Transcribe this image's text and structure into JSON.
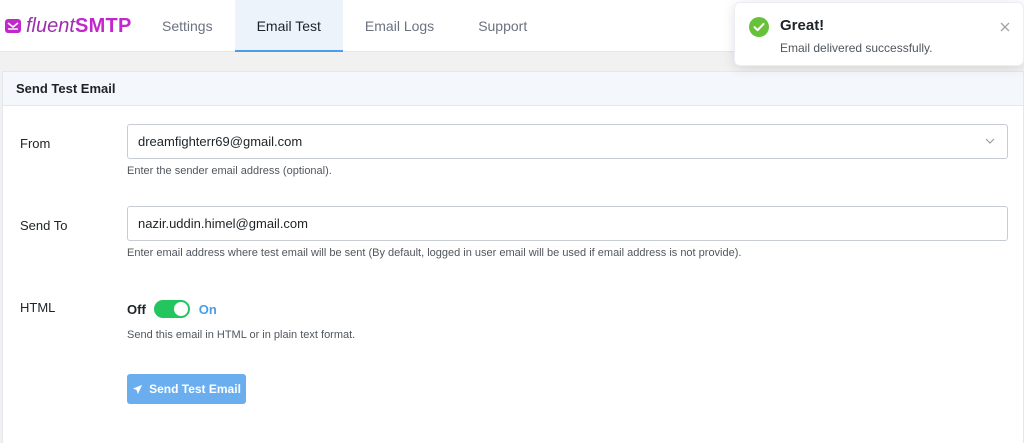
{
  "brand": {
    "fluent": "fluent",
    "smtp": "SMTP"
  },
  "nav": {
    "tabs": [
      {
        "label": "Settings"
      },
      {
        "label": "Email Test"
      },
      {
        "label": "Email Logs"
      },
      {
        "label": "Support"
      }
    ],
    "active": "Email Test"
  },
  "panel": {
    "title": "Send Test Email"
  },
  "form": {
    "from": {
      "label": "From",
      "value": "dreamfighterr69@gmail.com",
      "help": "Enter the sender email address (optional)."
    },
    "send_to": {
      "label": "Send To",
      "value": "nazir.uddin.himel@gmail.com",
      "help": "Enter email address where test email will be sent (By default, logged in user email will be used if email address is not provide)."
    },
    "html": {
      "label": "HTML",
      "off_label": "Off",
      "on_label": "On",
      "enabled": true,
      "help": "Send this email in HTML or in plain text format."
    },
    "submit_label": "Send Test Email"
  },
  "toast": {
    "title": "Great!",
    "message": "Email delivered successfully.",
    "icon": "check-circle-icon",
    "color": "#67c23a"
  },
  "colors": {
    "brand": "#c128cc",
    "accent": "#4b9de8",
    "toggle_on": "#22c55e",
    "button": "#6aaef0"
  }
}
